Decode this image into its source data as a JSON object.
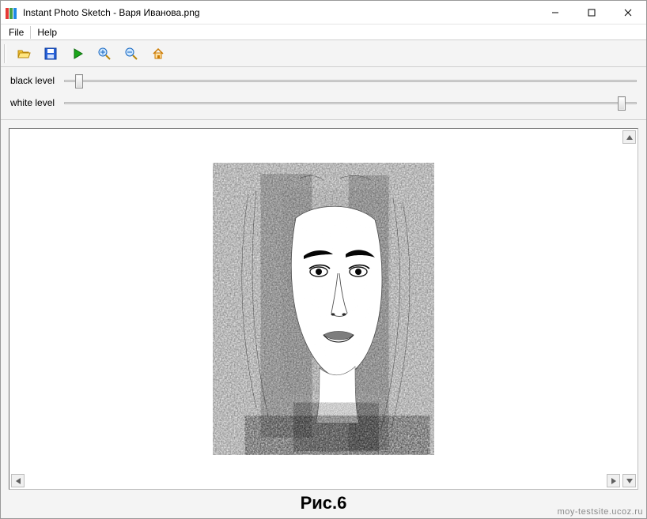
{
  "window": {
    "title": "Instant Photo Sketch - Варя Иванова.png"
  },
  "menu": {
    "file": "File",
    "help": "Help"
  },
  "toolbar": {
    "open": "open",
    "save": "save",
    "play": "play",
    "zoom_in": "zoom-in",
    "zoom_out": "zoom-out",
    "home": "home"
  },
  "sliders": {
    "black_label": "black level",
    "white_label": "white level",
    "black_value_pct": 2,
    "white_value_pct": 98
  },
  "caption": "Рис.6",
  "watermark": "moy-testsite.ucoz.ru"
}
